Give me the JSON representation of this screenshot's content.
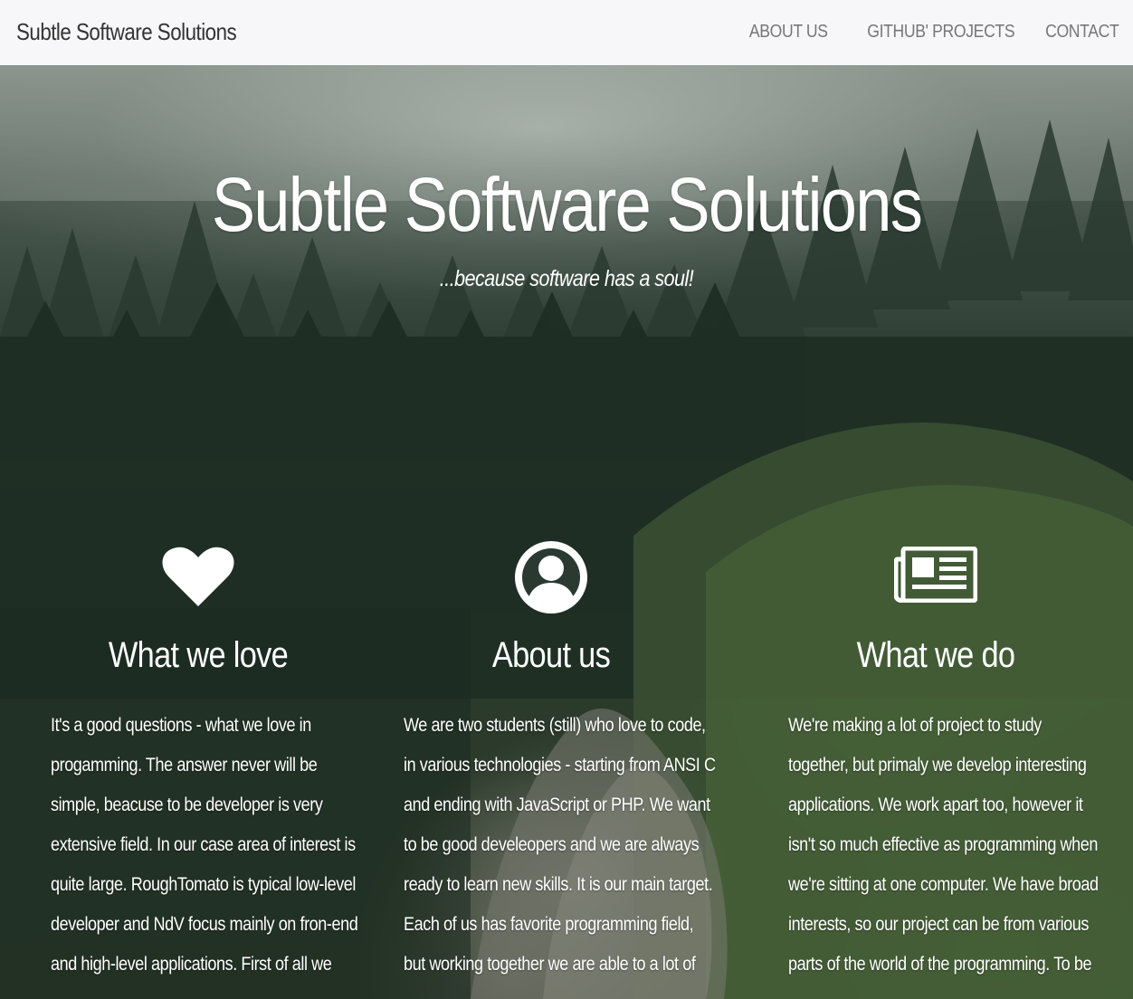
{
  "navbar": {
    "brand": "Subtle Software Solutions",
    "links": [
      {
        "label": "ABOUT US"
      },
      {
        "label": "GITHUB' PROJECTS"
      },
      {
        "label": "CONTACT"
      }
    ]
  },
  "hero": {
    "title": "Subtle Software Solutions",
    "subtitle": "...because software has a soul!",
    "background": "forest-photo"
  },
  "features": [
    {
      "icon": "heart-icon",
      "heading": "What we love",
      "lines": [
        "It's a good questions - what we love in",
        "progamming. The answer never will be",
        "simple, beacuse to be developer is very",
        "extensive field. In our case area of interest is",
        "quite large. RoughTomato is typical low-level",
        "developer and NdV focus mainly on fron-end",
        "and high-level applications. First of all we"
      ]
    },
    {
      "icon": "user-circle-icon",
      "heading": "About us",
      "lines": [
        "We are two students (still) who love to code,",
        "in various technologies - starting from ANSI C",
        "and ending with JavaScript or PHP. We want",
        "to be good develeopers and we are always",
        "ready to learn new skills. It is our main target.",
        "Each of us has favorite programming field,",
        "but working together we are able to a lot of"
      ]
    },
    {
      "icon": "newspaper-icon",
      "heading": "What we do",
      "lines": [
        "We're making a lot of project to study",
        "together, but primaly we develop interesting",
        "applications. We work apart too, however it",
        "isn't so much effective as programming when",
        "we're sitting at one computer. We have broad",
        "interests, so our project can be from various",
        "parts of the world of the programming. To be"
      ]
    }
  ],
  "colors": {
    "navbar_bg": "#f7f7f9",
    "brand_text": "#333333",
    "nav_link": "#777777",
    "hero_text": "#ffffff"
  }
}
